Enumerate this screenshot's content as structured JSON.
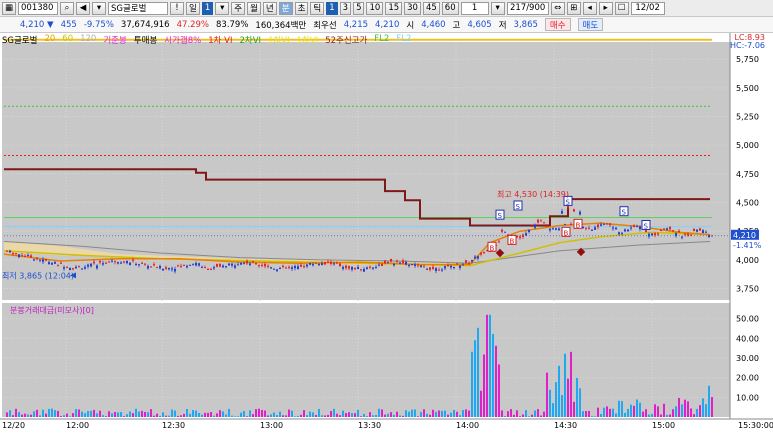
{
  "toolbar": {
    "code": "001380",
    "stock_name": "SG글로벌",
    "excl": "!",
    "period_day": "일",
    "period_num": "1",
    "periods": [
      "주",
      "월",
      "년",
      "분",
      "초",
      "틱"
    ],
    "minutes": [
      "1",
      "3",
      "5",
      "10",
      "15",
      "30",
      "45",
      "60"
    ],
    "interval": "1",
    "count": "217/900",
    "date": "12/02"
  },
  "quote": {
    "price": "4,210",
    "arrow": "▼",
    "change": "455",
    "rate": "-9.75%",
    "volume": "37,674,916",
    "ratio1": "47.29%",
    "ratio2": "83.79%",
    "amount": "160,364백만",
    "pref_label": "최우선",
    "bid": "4,215",
    "ask": "4,210",
    "open_label": "시",
    "open": "4,460",
    "high_label": "고",
    "high": "4,605",
    "low_label": "저",
    "low": "3,865",
    "buy": "매수",
    "sell": "매도"
  },
  "legend": [
    {
      "label": "SG글로벌",
      "color": "#000000"
    },
    {
      "label": "20",
      "color": "#e8a000"
    },
    {
      "label": "60",
      "color": "#c8c800"
    },
    {
      "label": "120",
      "color": "#b0b0b0"
    },
    {
      "label": "기준봉",
      "color": "#e020e0"
    },
    {
      "label": "투매봉",
      "color": "#000000"
    },
    {
      "label": "시가갭8%",
      "color": "#e020e0"
    },
    {
      "label": "1차 VI",
      "color": "#e02020"
    },
    {
      "label": "2차VI",
      "color": "#20a020"
    },
    {
      "label": "1차VI",
      "color": "#e8e020"
    },
    {
      "label": "1차VI",
      "color": "#e8e020"
    },
    {
      "label": "52주신고가",
      "color": "#902020"
    },
    {
      "label": "FL2",
      "color": "#40c040"
    },
    {
      "label": "FL2",
      "color": "#80d0ff"
    }
  ],
  "top_right": {
    "lc": "LC:8.93",
    "hc": "HC:-7.06"
  },
  "price_axis": {
    "ticks": [
      "5,750",
      "5,500",
      "5,250",
      "5,000",
      "4,750",
      "4,500",
      "4,250",
      "4,000",
      "3,750"
    ],
    "current": "4,210",
    "current_pct": "-1.41%"
  },
  "annotations": {
    "high": "최고 4,530 (14:39)",
    "low": "최저 3,865 (12:04)"
  },
  "volume_panel": {
    "title": "분봉거래대금(미모사)[0]",
    "ticks": [
      "50.00",
      "40.00",
      "30.00",
      "20.00",
      "10.00"
    ]
  },
  "time_axis": {
    "labels": [
      "12/20",
      "12:00",
      "12:30",
      "13:00",
      "13:30",
      "14:00",
      "14:30",
      "15:00",
      "15:30:00"
    ]
  },
  "chart_data": {
    "type": "candlestick",
    "price_ylim": [
      3650,
      5900
    ],
    "volume_ylim": [
      0,
      58
    ],
    "high": 4530,
    "low": 3865,
    "markers": {
      "S": [
        [
          4390,
          "14:07"
        ],
        [
          4470,
          "14:21"
        ],
        [
          4420,
          "14:41"
        ],
        [
          4300,
          "14:48"
        ],
        [
          4280,
          "14:56"
        ]
      ],
      "B": [
        [
          4110,
          "14:05"
        ],
        [
          4170,
          "14:14"
        ],
        [
          4240,
          "14:34"
        ],
        [
          4260,
          "14:39"
        ]
      ]
    }
  },
  "colors": {
    "up": "#e8222a",
    "down": "#2240d0",
    "vol_up": "#e020c8",
    "vol_down": "#20a8f0"
  }
}
